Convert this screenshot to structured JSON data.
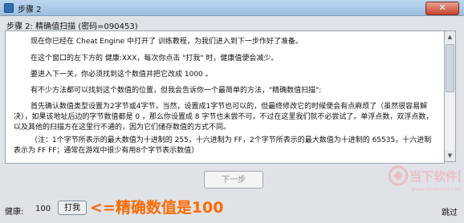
{
  "window": {
    "title": "步骤 2",
    "close_label": "✕"
  },
  "step_header": "步骤 2: 精确值扫描 (密码=090453)",
  "content": {
    "paragraphs": [
      "现在你已经在 Cheat Engine 中打开了 训练教程，为我们进入到下一步作好了准备。",
      "在这个窗口的左下方的 健康:XXX，每次你点击 \"打我\" 时，健康值便会减少。",
      "要进入下一关，你必须找到这个数值并把它改成 1000 。",
      "有不少方法都可以找到这个数值的位置，但我会告诉你一个最简单的方法，\"精确数值扫描\":",
      "首先确认数值类型设置为2字节或4字节，当然，设置成1字节也可以的，但最终修改它的时候便会有点麻烦了（虽然很容易解决），如果该地址后边的字节数值都是 0 ，那么你设置成 8 字节也未尝不可，不过在这里我们就不必尝试了。单浮点数，双浮点数，以及其他的扫描方在这里行不通的，因为它们储存数值的方式不同。",
      "（注：1个字节所表示的最大数值为十进制的 255，十六进制为 FF，2个字节所表示的最大数值为十进制的 65535，十六进制表示为 FF FF；通常在游戏中很少有用8个字节表示数值）"
    ]
  },
  "buttons": {
    "next_label": "下一步",
    "hit_label": "打我",
    "skip_label": "跳过"
  },
  "status": {
    "health_label": "健康:",
    "health_value": "100"
  },
  "annotation": "<=精确数值是100",
  "watermark": {
    "brand": "当下软件园",
    "url": "www.downxia.com"
  },
  "colors": {
    "annotation": "#ff6a00",
    "watermark": "#f5a0a6"
  }
}
